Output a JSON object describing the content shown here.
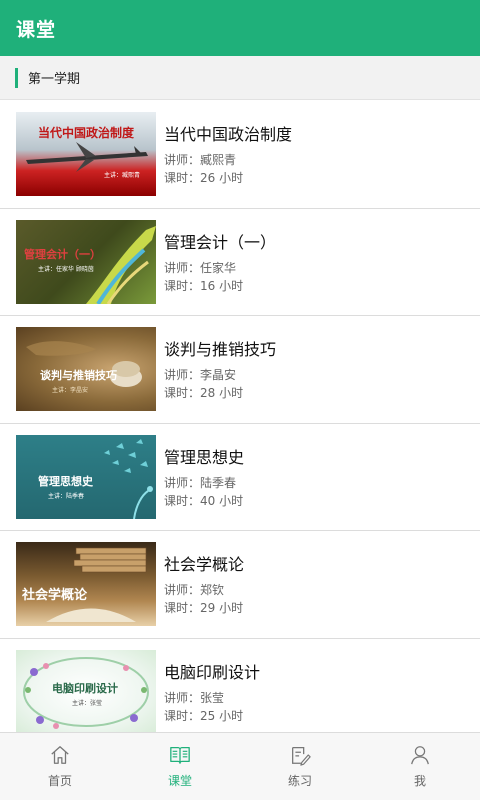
{
  "header": {
    "title": "课堂"
  },
  "section": {
    "label": "第一学期"
  },
  "courses": [
    {
      "title": "当代中国政治制度",
      "teacher": "讲师：臧熙青",
      "hours": "课时：26 小时",
      "thumb_title": "当代中国政治制度",
      "thumb_sub": "主讲：臧熙青"
    },
    {
      "title": "管理会计（一）",
      "teacher": "讲师：任家华",
      "hours": "课时：16 小时",
      "thumb_title": "管理会计（一）",
      "thumb_sub": "主讲：任家华 顾晓茵"
    },
    {
      "title": "谈判与推销技巧",
      "teacher": "讲师：李晶安",
      "hours": "课时：28 小时",
      "thumb_title": "谈判与推销技巧",
      "thumb_sub": "主讲：李晶安"
    },
    {
      "title": "管理思想史",
      "teacher": "讲师：陆季春",
      "hours": "课时：40 小时",
      "thumb_title": "管理思想史",
      "thumb_sub": "主讲：陆季春"
    },
    {
      "title": "社会学概论",
      "teacher": "讲师：郑钦",
      "hours": "课时：29 小时",
      "thumb_title": "社会学概论",
      "thumb_sub": ""
    },
    {
      "title": "电脑印刷设计",
      "teacher": "讲师：张莹",
      "hours": "课时：25 小时",
      "thumb_title": "电脑印刷设计",
      "thumb_sub": "主讲：张莹"
    }
  ],
  "tabs": [
    {
      "label": "首页",
      "icon": "home-icon"
    },
    {
      "label": "课堂",
      "icon": "book-icon"
    },
    {
      "label": "练习",
      "icon": "edit-icon"
    },
    {
      "label": "我",
      "icon": "user-icon"
    }
  ],
  "colors": {
    "accent": "#1fb07a"
  }
}
